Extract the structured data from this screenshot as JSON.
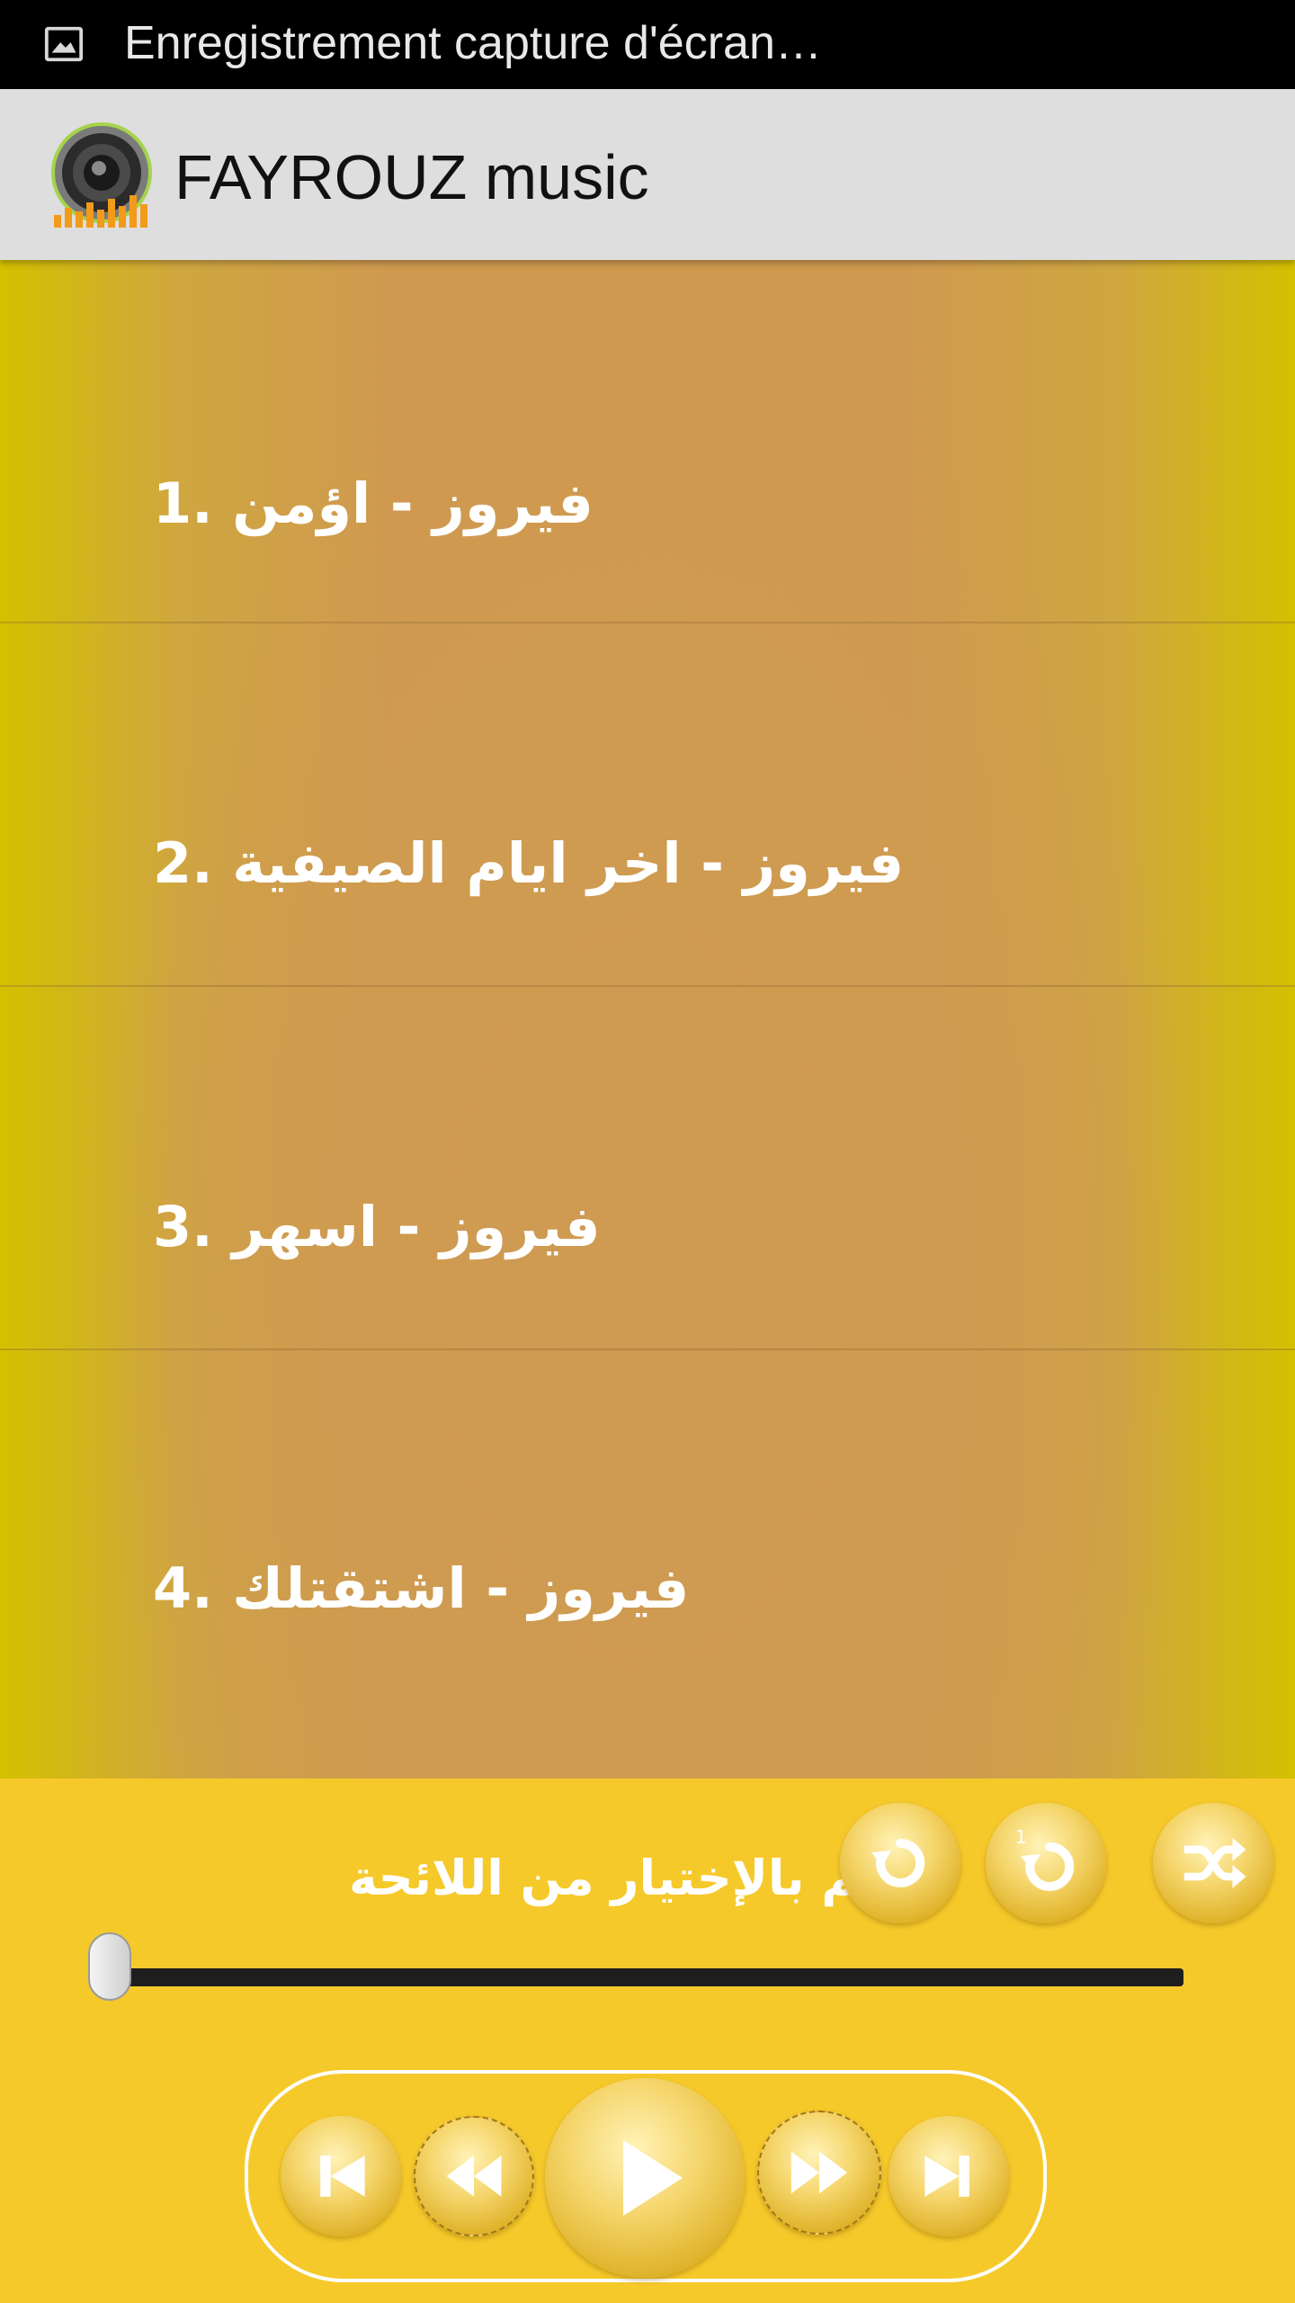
{
  "status_bar": {
    "text": "Enregistrement capture d'écran…",
    "icon": "image-icon"
  },
  "app_bar": {
    "title": "FAYROUZ music",
    "icon": "speaker-icon"
  },
  "playlist": {
    "items": [
      {
        "label": "1. فيروز - اؤمن"
      },
      {
        "label": "2. فيروز - اخر ايام الصيفية"
      },
      {
        "label": "3. فيروز - اسهر"
      },
      {
        "label": "4. فيروز - اشتقتلك"
      }
    ]
  },
  "player": {
    "now_playing": "قم بالإختيار من اللائحة",
    "progress": 0,
    "mode_buttons": [
      "repeat-icon",
      "repeat-one-icon",
      "shuffle-icon"
    ],
    "transport_buttons": [
      "skip-previous-icon",
      "rewind-icon",
      "play-icon",
      "fast-forward-icon",
      "skip-next-icon"
    ]
  },
  "colors": {
    "panel": "#f6c92b",
    "list_center": "#cf9a50",
    "list_edge": "#d5c000",
    "app_bar": "#dedede"
  }
}
